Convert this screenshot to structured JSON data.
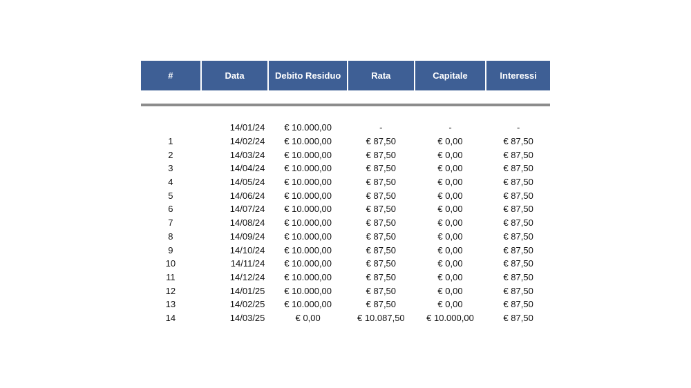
{
  "table": {
    "headers": [
      "#",
      "Data",
      "Debito Residuo",
      "Rata",
      "Capitale",
      "Interessi"
    ],
    "rows": [
      {
        "n": "",
        "data": "14/01/24",
        "debito": "€ 10.000,00",
        "rata": "-",
        "capitale": "-",
        "interessi": "-"
      },
      {
        "n": "1",
        "data": "14/02/24",
        "debito": "€ 10.000,00",
        "rata": "€ 87,50",
        "capitale": "€ 0,00",
        "interessi": "€ 87,50"
      },
      {
        "n": "2",
        "data": "14/03/24",
        "debito": "€ 10.000,00",
        "rata": "€ 87,50",
        "capitale": "€ 0,00",
        "interessi": "€ 87,50"
      },
      {
        "n": "3",
        "data": "14/04/24",
        "debito": "€ 10.000,00",
        "rata": "€ 87,50",
        "capitale": "€ 0,00",
        "interessi": "€ 87,50"
      },
      {
        "n": "4",
        "data": "14/05/24",
        "debito": "€ 10.000,00",
        "rata": "€ 87,50",
        "capitale": "€ 0,00",
        "interessi": "€ 87,50"
      },
      {
        "n": "5",
        "data": "14/06/24",
        "debito": "€ 10.000,00",
        "rata": "€ 87,50",
        "capitale": "€ 0,00",
        "interessi": "€ 87,50"
      },
      {
        "n": "6",
        "data": "14/07/24",
        "debito": "€ 10.000,00",
        "rata": "€ 87,50",
        "capitale": "€ 0,00",
        "interessi": "€ 87,50"
      },
      {
        "n": "7",
        "data": "14/08/24",
        "debito": "€ 10.000,00",
        "rata": "€ 87,50",
        "capitale": "€ 0,00",
        "interessi": "€ 87,50"
      },
      {
        "n": "8",
        "data": "14/09/24",
        "debito": "€ 10.000,00",
        "rata": "€ 87,50",
        "capitale": "€ 0,00",
        "interessi": "€ 87,50"
      },
      {
        "n": "9",
        "data": "14/10/24",
        "debito": "€ 10.000,00",
        "rata": "€ 87,50",
        "capitale": "€ 0,00",
        "interessi": "€ 87,50"
      },
      {
        "n": "10",
        "data": "14/11/24",
        "debito": "€ 10.000,00",
        "rata": "€ 87,50",
        "capitale": "€ 0,00",
        "interessi": "€ 87,50"
      },
      {
        "n": "11",
        "data": "14/12/24",
        "debito": "€ 10.000,00",
        "rata": "€ 87,50",
        "capitale": "€ 0,00",
        "interessi": "€ 87,50"
      },
      {
        "n": "12",
        "data": "14/01/25",
        "debito": "€ 10.000,00",
        "rata": "€ 87,50",
        "capitale": "€ 0,00",
        "interessi": "€ 87,50"
      },
      {
        "n": "13",
        "data": "14/02/25",
        "debito": "€ 10.000,00",
        "rata": "€ 87,50",
        "capitale": "€ 0,00",
        "interessi": "€ 87,50"
      },
      {
        "n": "14",
        "data": "14/03/25",
        "debito": "€ 0,00",
        "rata": "€ 10.087,50",
        "capitale": "€ 10.000,00",
        "interessi": "€ 87,50"
      }
    ]
  },
  "colors": {
    "header_bg": "#3e5f95",
    "header_text": "#ffffff",
    "divider": "#8c8c8c"
  }
}
